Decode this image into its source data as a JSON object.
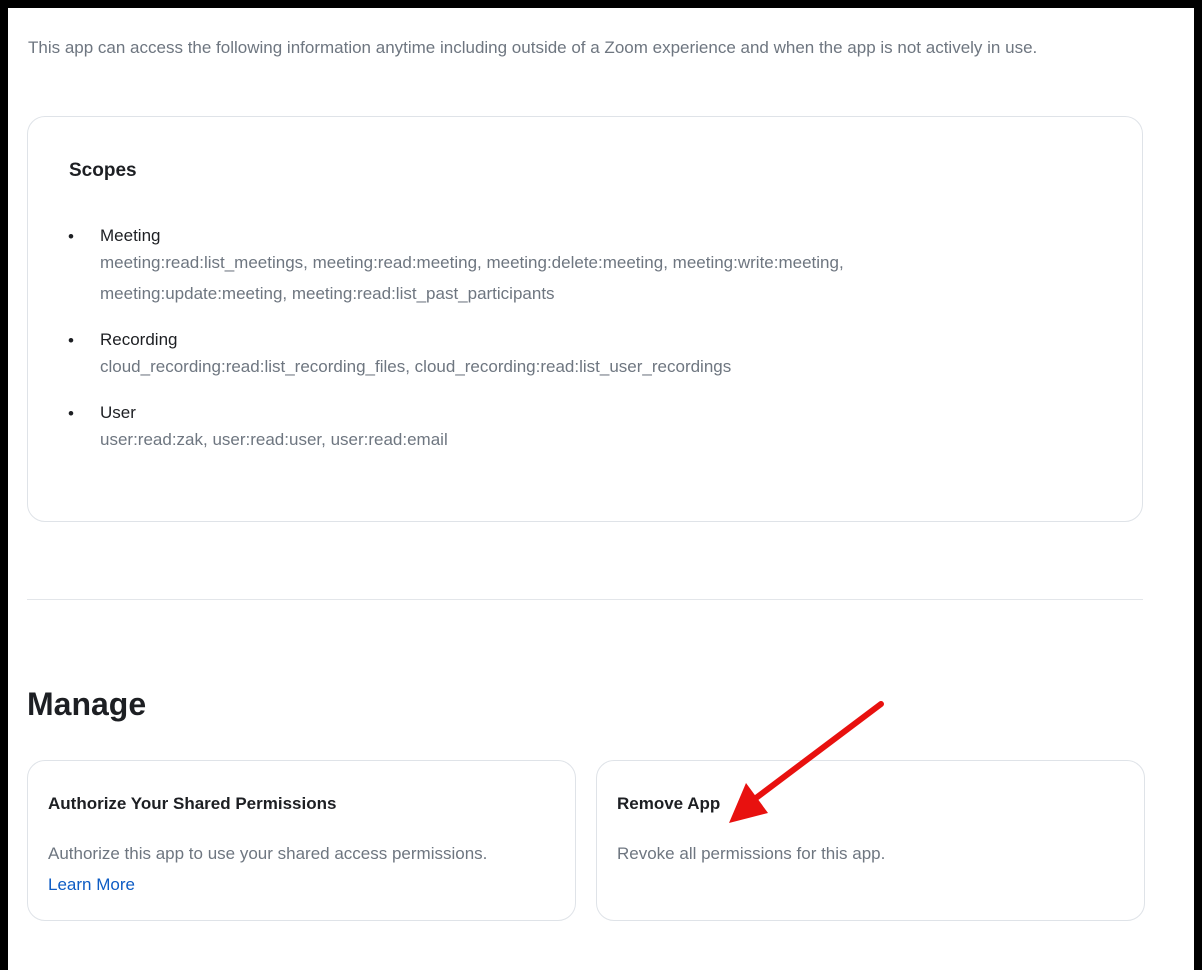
{
  "intro_text": "This app can access the following information anytime including outside of a Zoom experience and when the app is not actively in use.",
  "scopes": {
    "title": "Scopes",
    "items": [
      {
        "name": "Meeting",
        "perms_line1": "meeting:read:list_meetings, meeting:read:meeting, meeting:delete:meeting, meeting:write:meeting,",
        "perms_line2": "meeting:update:meeting, meeting:read:list_past_participants"
      },
      {
        "name": "Recording",
        "perms_line1": "cloud_recording:read:list_recording_files, cloud_recording:read:list_user_recordings"
      },
      {
        "name": "User",
        "perms_line1": "user:read:zak, user:read:user, user:read:email"
      }
    ]
  },
  "manage": {
    "title": "Manage",
    "authorize_card": {
      "title": "Authorize Your Shared Permissions",
      "description": "Authorize this app to use your shared access permissions.",
      "link_label": "Learn More"
    },
    "remove_card": {
      "title": "Remove App",
      "description": "Revoke all permissions for this app."
    }
  },
  "colors": {
    "annotation_arrow": "#e8110f",
    "link": "#0e5cc4"
  }
}
